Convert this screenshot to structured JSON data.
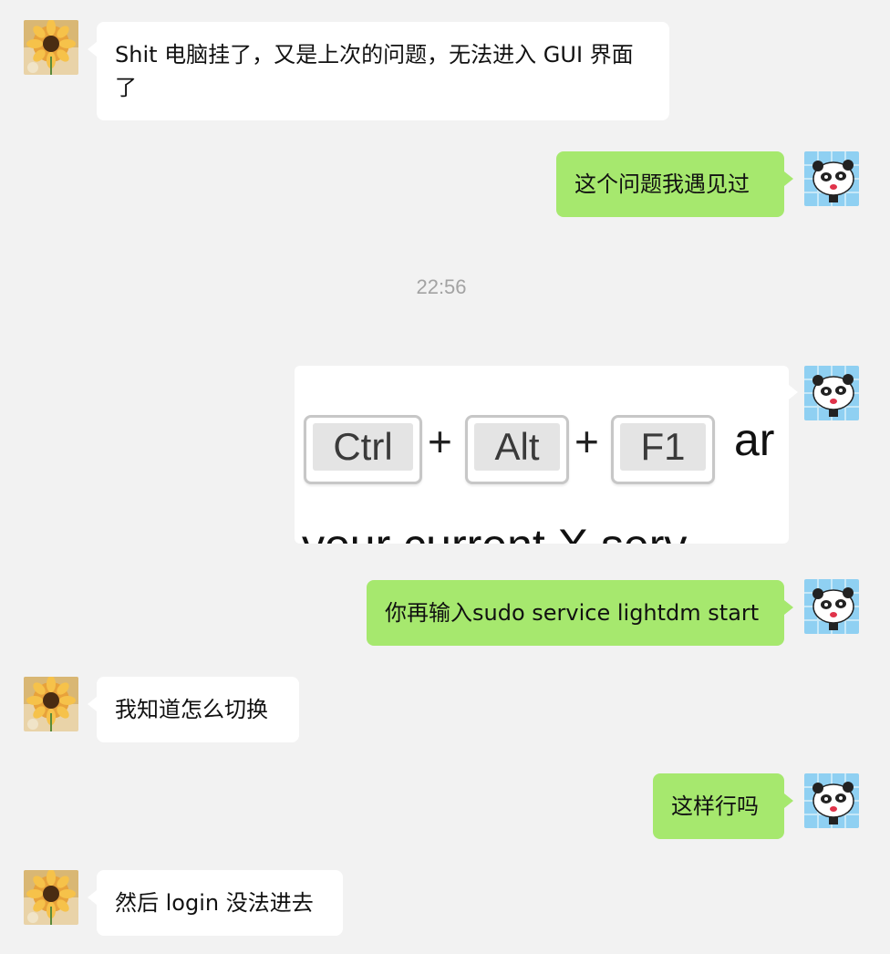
{
  "messages": [
    {
      "text": "Shit 电脑挂了，又是上次的问题，无法进入 GUI 界面了"
    },
    {
      "text": "这个问题我遇见过"
    },
    {
      "text": "你再输入sudo service lightdm start"
    },
    {
      "text": "我知道怎么切换"
    },
    {
      "text": "这样行吗"
    },
    {
      "text": "然后 login 没法进去"
    }
  ],
  "timestamp": "22:56",
  "image_message": {
    "keys": [
      "Ctrl",
      "Alt",
      "F1"
    ],
    "plus": "+",
    "trailing_text": "ar",
    "cut_line": "your current X serv"
  },
  "avatars": {
    "contact": "sunflower-avatar-icon",
    "self": "panda-avatar-icon"
  },
  "colors": {
    "background": "#f2f2f2",
    "incoming_bubble": "#ffffff",
    "outgoing_bubble": "#a6e86e",
    "timestamp": "#a3a3a3"
  }
}
